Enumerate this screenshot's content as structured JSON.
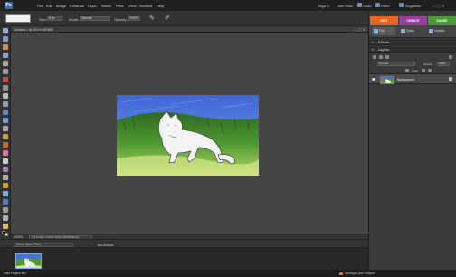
{
  "menubar": {
    "logo": "Ps",
    "items": [
      "File",
      "Edit",
      "Image",
      "Enhance",
      "Layer",
      "Select",
      "Filter",
      "View",
      "Window",
      "Help"
    ],
    "sign_in": "Sign In",
    "join_now": "Join Now",
    "undo": "Undo",
    "redo": "Redo",
    "organizer": "Organizer"
  },
  "options": {
    "size_label": "Size:",
    "size_value": "5 px",
    "mode_label": "Mode:",
    "mode_value": "Normal",
    "opacity_label": "Opacity:",
    "opacity_value": "100%"
  },
  "document": {
    "title": "Untitled-1 @ 100% (RGB/8)",
    "window_controls": "— ▢ ✕",
    "zoom": "100%",
    "info": "1.3 inches x 0.833 inches (229.958 ppi)"
  },
  "project_bin": {
    "show_label": "Show Open Files",
    "actions_label": "Bin Actions",
    "hide_label": "Hide Project Bin",
    "spotlight": "Spotlight your subject"
  },
  "right_panel": {
    "tabs": [
      {
        "label": "EDIT",
        "color": "#e8661e"
      },
      {
        "label": "CREATE",
        "color": "#9b3d9b"
      },
      {
        "label": "SHARE",
        "color": "#4c9a3a"
      }
    ],
    "subtabs": [
      "Full",
      "Quick",
      "Guided"
    ],
    "effects_label": "Effects",
    "layers_label": "Layers",
    "blend_mode": "Normal",
    "opacity_label": "Opacity:",
    "opacity_value": "100%",
    "lock_label": "Lock:",
    "layer_name": "Background"
  },
  "colors": {
    "accent_blue": "#3a6fa8",
    "edit_orange": "#e8661e"
  }
}
